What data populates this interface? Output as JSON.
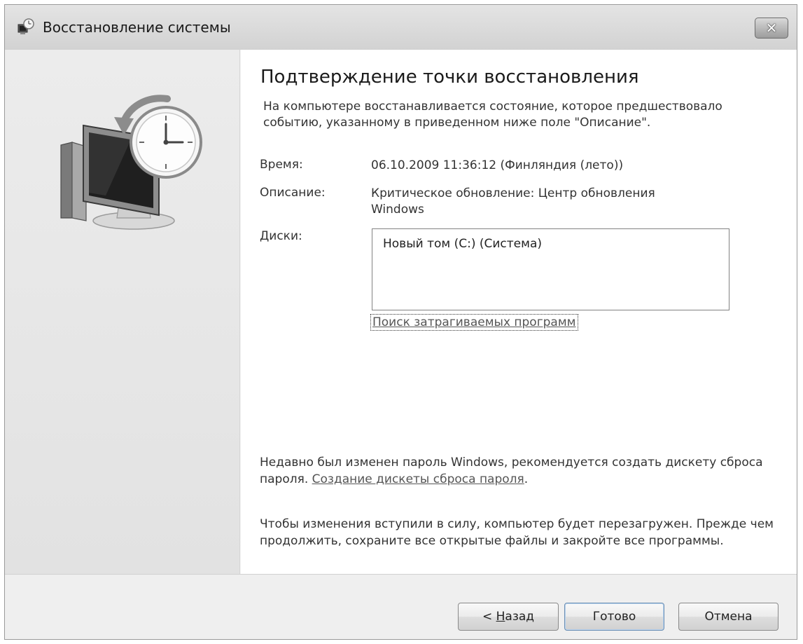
{
  "window": {
    "title": "Восстановление системы",
    "close_label": "✕"
  },
  "content": {
    "heading": "Подтверждение точки восстановления",
    "intro": "На компьютере восстанавливается состояние, которое предшествовало событию, указанному в приведенном ниже поле \"Описание\".",
    "time_label": "Время:",
    "time_value": "06.10.2009 11:36:12 (Финляндия (лето))",
    "description_label": "Описание:",
    "description_value": "Критическое обновление: Центр обновления Windows",
    "disks_label": "Диски:",
    "disks": [
      "Новый том (C:) (Система)"
    ],
    "scan_link": "Поиск затрагиваемых программ",
    "password_note": "Недавно был изменен пароль Windows, рекомендуется создать дискету сброса пароля.",
    "password_link": "Создание дискеты сброса пароля",
    "password_link_suffix": ".",
    "restart_note": "Чтобы изменения вступили в силу, компьютер будет перезагружен. Прежде чем продолжить, сохраните все открытые файлы и закройте все программы."
  },
  "buttons": {
    "back_prefix": "< ",
    "back_mnemonic": "Н",
    "back_rest": "азад",
    "finish": "Готово",
    "cancel": "Отмена"
  },
  "icons": {
    "title": "system-restore-icon",
    "main": "monitor-clock-restore-icon"
  }
}
